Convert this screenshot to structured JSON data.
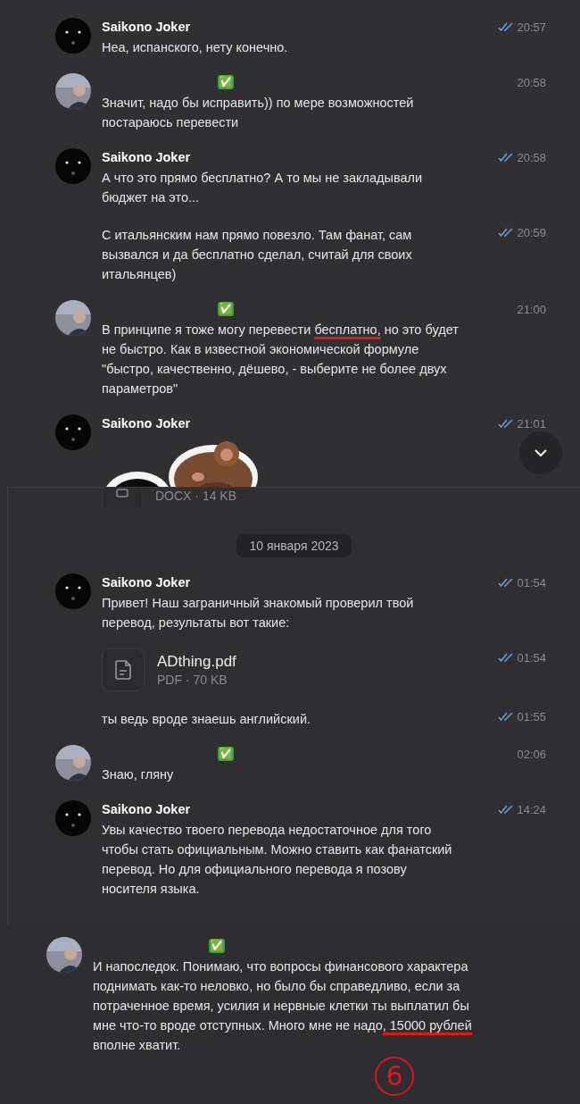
{
  "sections": [
    {
      "scroll_down_button": true,
      "messages": [
        {
          "kind": "text",
          "avatar": {
            "kind": "cat"
          },
          "sender": "Saikono Joker",
          "time": "20:57",
          "read": true,
          "parts": [
            {
              "text": "Неа, испанского, нету конечно.",
              "underlined": false
            }
          ]
        },
        {
          "kind": "text",
          "badge": "✅",
          "time": "20:58",
          "read": false,
          "parts": [
            {
              "text": "Значит, надо бы исправить)) по мере возможностей постараюсь перевести",
              "underlined": false
            }
          ]
        },
        {
          "kind": "text",
          "avatar": {
            "kind": "cat"
          },
          "sender": "Saikono Joker",
          "time": "20:58",
          "read": true,
          "parts": [
            {
              "text": "А что это прямо бесплатно? А то мы не закладывали бюджет на это...",
              "underlined": false
            }
          ]
        },
        {
          "kind": "text",
          "time": "20:59",
          "read": true,
          "parts": [
            {
              "text": "С итальянским нам прямо повезло. Там фанат, сам вызвался и да бесплатно сделал, считай для своих итальянцев)",
              "underlined": false
            }
          ]
        },
        {
          "kind": "text",
          "badge": "✅",
          "time": "21:00",
          "read": false,
          "parts": [
            {
              "text": "В принципе я тоже могу перевести ",
              "underlined": false
            },
            {
              "text": "бесплатно,",
              "underlined": true
            },
            {
              "text": " но это будет не быстро. Как в известной экономической формуле \"быстро, качественно, дёшево, - выберите не более двух параметров\"",
              "underlined": false
            }
          ]
        },
        {
          "kind": "sticker",
          "avatar": {
            "kind": "cat"
          },
          "sender": "Saikono Joker",
          "time": "21:01",
          "read": true
        }
      ]
    },
    {
      "messages": [
        {
          "kind": "file_cut",
          "meta": "DOCX · 14 KB"
        },
        {
          "kind": "date",
          "label": "10 января 2023"
        },
        {
          "kind": "text",
          "avatar": {
            "kind": "cat"
          },
          "sender": "Saikono Joker",
          "time": "01:54",
          "read": true,
          "parts": [
            {
              "text": "Привет! Наш заграничный знакомый проверил твой перевод, результаты вот такие:",
              "underlined": false
            }
          ]
        },
        {
          "kind": "file",
          "name": "ADthing.pdf",
          "meta": "PDF · 70 KB",
          "time": "01:54",
          "read": true
        },
        {
          "kind": "text",
          "time": "01:55",
          "read": true,
          "parts": [
            {
              "text": "ты ведь вроде знаешь английский.",
              "underlined": false
            }
          ]
        },
        {
          "kind": "text",
          "badge": "✅",
          "time": "02:06",
          "read": false,
          "parts": [
            {
              "text": "Знаю, гляну",
              "underlined": false
            }
          ]
        },
        {
          "kind": "text",
          "avatar": {
            "kind": "cat"
          },
          "sender": "Saikono Joker",
          "time": "14:24",
          "read": true,
          "parts": [
            {
              "text": "Увы качество твоего перевода недостаточное для того чтобы стать официальным. Можно ставить как фанатский перевод. Но для официального перевода я позову носителя языка.",
              "underlined": false
            }
          ]
        }
      ]
    },
    {
      "annotation": "6",
      "messages": [
        {
          "kind": "text",
          "badge": "✅",
          "read": false,
          "parts": [
            {
              "text": "И напоследок. Понимаю, что вопросы финансового характера поднимать как-то неловко, но было бы справедливо, если за потраченное время, усилия и нервные клетки ты выплатил бы мне что-то вроде отступных. Много мне не надо",
              "underlined": false
            },
            {
              "text": ", 15000 рублей",
              "underlined": true
            },
            {
              "text": " вполне хватит.",
              "underlined": false
            }
          ]
        }
      ]
    }
  ]
}
